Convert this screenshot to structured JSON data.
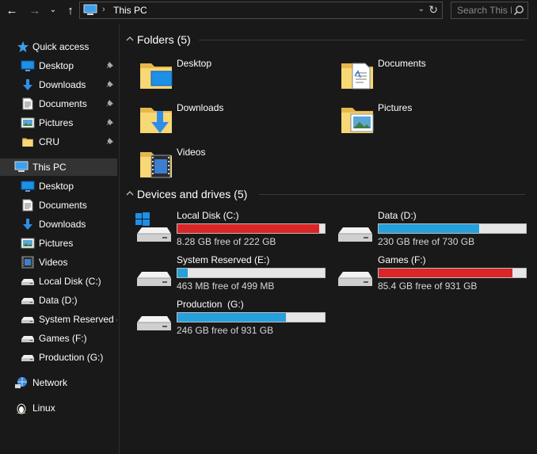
{
  "address": {
    "location": "This PC",
    "separator": "›",
    "search_placeholder": "Search This PC",
    "icons": {
      "back": "arrow-left-icon",
      "forward": "arrow-right-icon",
      "recent": "chevron-down-icon",
      "up": "arrow-up-icon",
      "refresh": "refresh-icon",
      "search": "search-icon"
    }
  },
  "sidebar": {
    "quick_access": {
      "label": "Quick access",
      "items": [
        {
          "label": "Desktop",
          "icon": "desktop-icon",
          "pinned": true
        },
        {
          "label": "Downloads",
          "icon": "downloads-icon",
          "pinned": true
        },
        {
          "label": "Documents",
          "icon": "documents-icon",
          "pinned": true
        },
        {
          "label": "Pictures",
          "icon": "pictures-icon",
          "pinned": true
        },
        {
          "label": "CRU",
          "icon": "folder-icon",
          "pinned": true
        }
      ]
    },
    "this_pc": {
      "label": "This PC",
      "selected": true,
      "items": [
        {
          "label": "Desktop",
          "icon": "desktop-icon"
        },
        {
          "label": "Documents",
          "icon": "documents-icon"
        },
        {
          "label": "Downloads",
          "icon": "downloads-icon"
        },
        {
          "label": "Pictures",
          "icon": "pictures-icon"
        },
        {
          "label": "Videos",
          "icon": "videos-icon"
        },
        {
          "label": "Local Disk (C:)",
          "icon": "drive-icon"
        },
        {
          "label": "Data (D:)",
          "icon": "drive-icon"
        },
        {
          "label": "System Reserved (E:)",
          "icon": "drive-icon"
        },
        {
          "label": "Games (F:)",
          "icon": "drive-icon"
        },
        {
          "label": "Production  (G:)",
          "icon": "drive-icon"
        }
      ]
    },
    "network": {
      "label": "Network",
      "icon": "network-icon"
    },
    "linux": {
      "label": "Linux",
      "icon": "linux-icon"
    }
  },
  "folders": {
    "title": "Folders (5)",
    "items": [
      {
        "label": "Desktop",
        "icon": "desktop-folder-icon"
      },
      {
        "label": "Documents",
        "icon": "documents-folder-icon"
      },
      {
        "label": "Downloads",
        "icon": "downloads-folder-icon"
      },
      {
        "label": "Pictures",
        "icon": "pictures-folder-icon"
      },
      {
        "label": "Videos",
        "icon": "videos-folder-icon"
      }
    ]
  },
  "drives": {
    "title": "Devices and drives (5)",
    "items": [
      {
        "name": "Local Disk (C:)",
        "free": "8.28 GB free of 222 GB",
        "used_fraction": 0.963,
        "bar_color": "#da2626",
        "windows_logo": true
      },
      {
        "name": "Data (D:)",
        "free": "230 GB free of 730 GB",
        "used_fraction": 0.685,
        "bar_color": "#26a0da",
        "windows_logo": false
      },
      {
        "name": "System Reserved (E:)",
        "free": "463 MB free of 499 MB",
        "used_fraction": 0.072,
        "bar_color": "#26a0da",
        "windows_logo": false
      },
      {
        "name": "Games (F:)",
        "free": "85.4 GB free of 931 GB",
        "used_fraction": 0.908,
        "bar_color": "#da2626",
        "windows_logo": false
      },
      {
        "name": "Production  (G:)",
        "free": "246 GB free of 931 GB",
        "used_fraction": 0.736,
        "bar_color": "#26a0da",
        "windows_logo": false
      }
    ]
  },
  "colors": {
    "background": "#191919",
    "selected": "#333333",
    "bar_normal": "#26a0da",
    "bar_warning": "#da2626",
    "folder_yellow": "#f8d775"
  }
}
